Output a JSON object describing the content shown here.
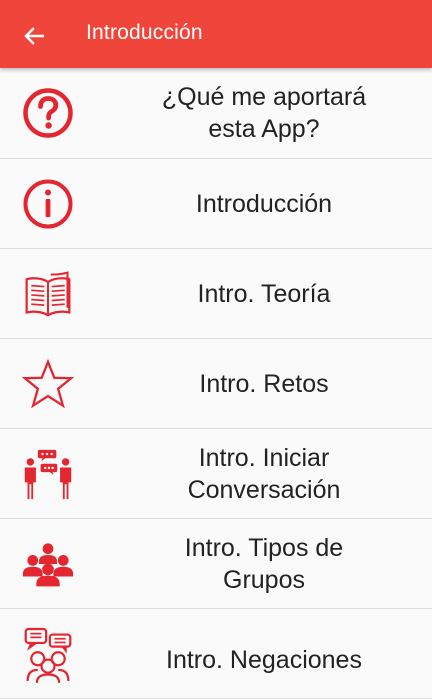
{
  "colors": {
    "appbar": "#f0453b",
    "accent": "#e3262f",
    "text": "#222222"
  },
  "appbar": {
    "title": "Introducción",
    "back_icon": "arrow-left-icon"
  },
  "items": [
    {
      "icon": "question-circle-icon",
      "lines": [
        "¿Qué me aportará",
        "esta App?"
      ]
    },
    {
      "icon": "info-circle-icon",
      "lines": [
        "Introducción"
      ]
    },
    {
      "icon": "open-book-icon",
      "lines": [
        "Intro. Teoría"
      ]
    },
    {
      "icon": "star-outline-icon",
      "lines": [
        "Intro. Retos"
      ]
    },
    {
      "icon": "people-talking-icon",
      "lines": [
        "Intro. Iniciar",
        "Conversación"
      ]
    },
    {
      "icon": "group-people-icon",
      "lines": [
        "Intro. Tipos de",
        "Grupos"
      ]
    },
    {
      "icon": "people-chat-bubbles-icon",
      "lines": [
        "Intro. Negaciones"
      ]
    }
  ]
}
